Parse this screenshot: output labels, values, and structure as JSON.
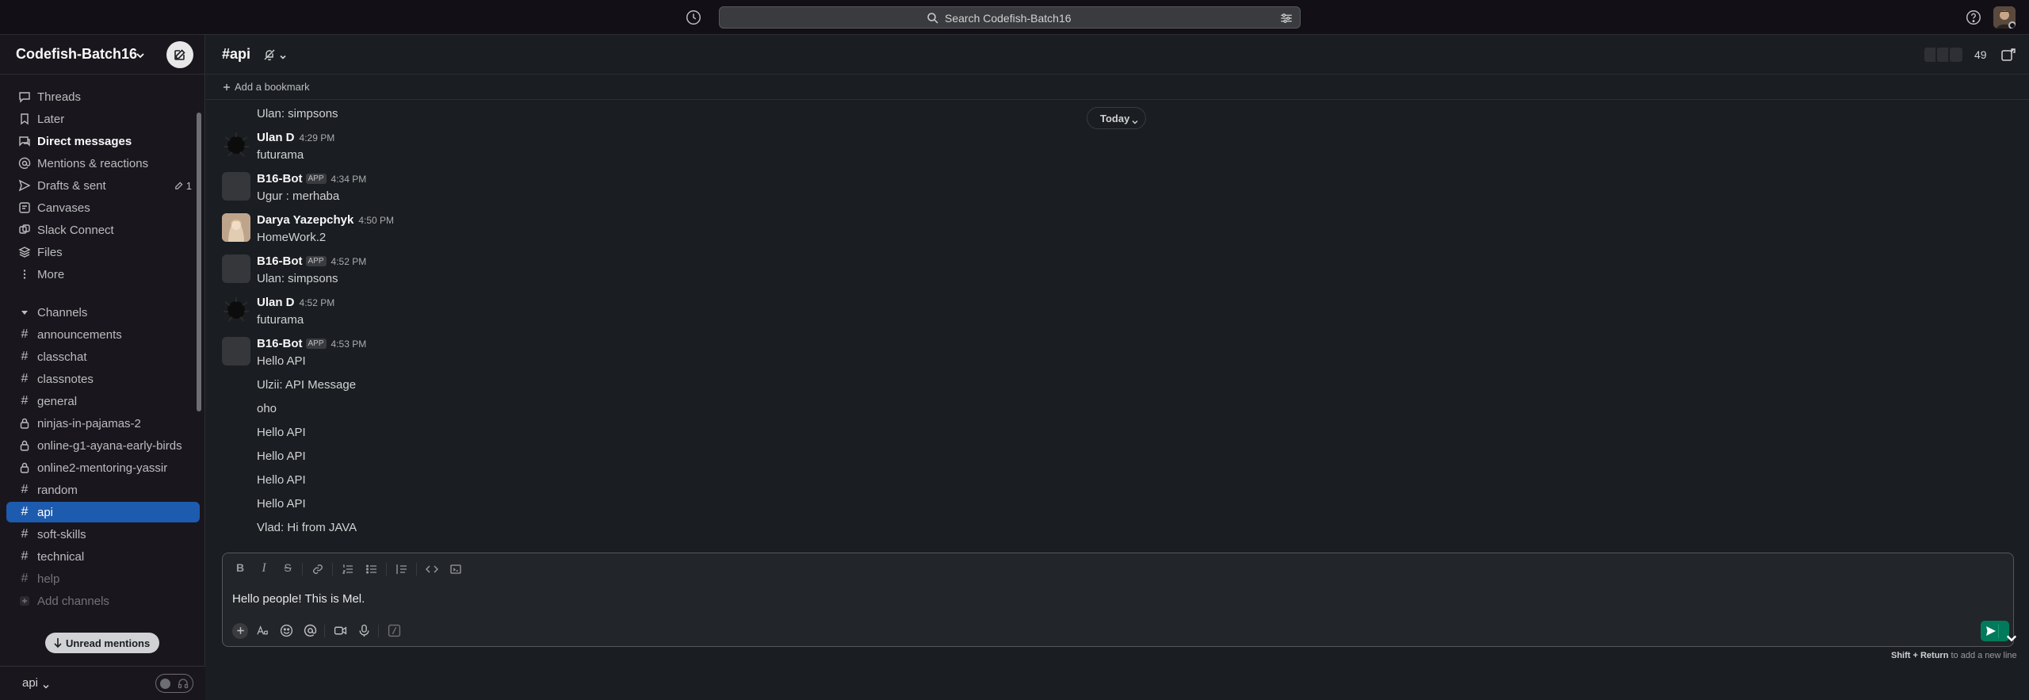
{
  "topbar": {
    "search_placeholder": "Search Codefish-Batch16"
  },
  "workspace": {
    "name": "Codefish-Batch16"
  },
  "nav": {
    "threads": "Threads",
    "later": "Later",
    "direct_messages": "Direct messages",
    "mentions": "Mentions & reactions",
    "drafts": "Drafts & sent",
    "drafts_count": "1",
    "canvases": "Canvases",
    "slack_connect": "Slack Connect",
    "files": "Files",
    "more": "More"
  },
  "channels": {
    "section_label": "Channels",
    "items": [
      {
        "label": "announcements",
        "icon": "hash"
      },
      {
        "label": "classchat",
        "icon": "hash"
      },
      {
        "label": "classnotes",
        "icon": "hash"
      },
      {
        "label": "general",
        "icon": "hash"
      },
      {
        "label": "ninjas-in-pajamas-2",
        "icon": "lock"
      },
      {
        "label": "online-g1-ayana-early-birds",
        "icon": "lock"
      },
      {
        "label": "online2-mentoring-yassir",
        "icon": "lock"
      },
      {
        "label": "random",
        "icon": "hash"
      },
      {
        "label": "api",
        "icon": "hash",
        "active": true
      },
      {
        "label": "soft-skills",
        "icon": "hash"
      },
      {
        "label": "technical",
        "icon": "hash"
      },
      {
        "label": "help",
        "icon": "hash"
      }
    ],
    "add_label": "Add channels"
  },
  "unread_pill": "Unread mentions",
  "footer": {
    "channel": "api"
  },
  "channel_header": {
    "name": "api",
    "member_count": "49"
  },
  "bookmark": {
    "add_label": "Add a bookmark"
  },
  "date_divider": "Today",
  "messages": {
    "m0_text": "Ulan: simpsons",
    "m1": {
      "author": "Ulan D",
      "time": "4:29 PM",
      "text": "futurama"
    },
    "m2": {
      "author": "B16-Bot",
      "badge": "APP",
      "time": "4:34 PM",
      "text": "Ugur : merhaba"
    },
    "m3": {
      "author": "Darya Yazepchyk",
      "time": "4:50 PM",
      "text": "HomeWork.2"
    },
    "m4": {
      "author": "B16-Bot",
      "badge": "APP",
      "time": "4:52 PM",
      "text": "Ulan: simpsons"
    },
    "m5": {
      "author": "Ulan D",
      "time": "4:52 PM",
      "text": "futurama"
    },
    "m6": {
      "author": "B16-Bot",
      "badge": "APP",
      "time": "4:53 PM",
      "text": "Hello API"
    },
    "followups": [
      "Ulzii: API Message",
      "oho",
      "Hello API",
      "Hello API",
      "Hello API",
      "Hello API",
      "Vlad: Hi from JAVA"
    ]
  },
  "composer": {
    "value": "Hello people! This is Mel."
  },
  "hint": {
    "keys": "Shift + Return",
    "suffix": "to add a new line"
  }
}
